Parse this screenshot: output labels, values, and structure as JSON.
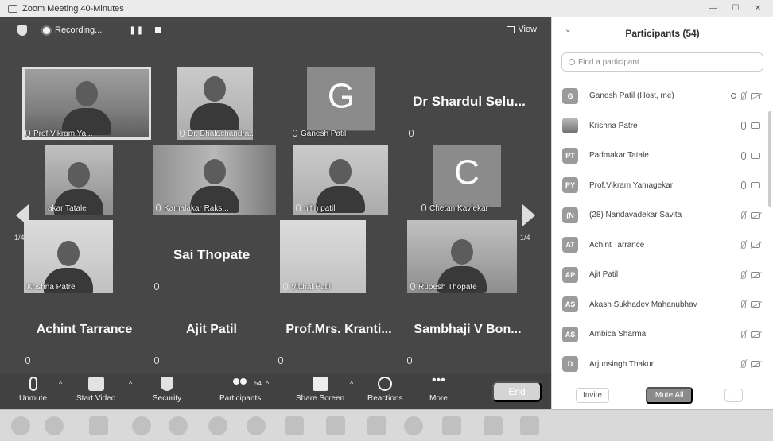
{
  "window": {
    "title": "Zoom Meeting 40-Minutes"
  },
  "topbar": {
    "recording_label": "Recording...",
    "pause_glyph": "❚❚",
    "view_label": "View"
  },
  "tiles": {
    "t1": "Prof.Vikram Ya...",
    "t2": "Dr. Bhalachandra...",
    "t3": "Ganesh Patil",
    "t3_letter": "G",
    "t4": "Dr Shardul Selu...",
    "t5": "akar Tatale",
    "t6": "Kamalakar Raks...",
    "t7": "nitin patil",
    "t8": "Chetan Kavlekar",
    "t8_letter": "C",
    "t9": "Krishna Patre",
    "t10": "Sai Thopate",
    "t11": "Vitthal Patil",
    "t12": "Rupesh Thopate",
    "t13": "Achint Tarrance",
    "t14": "Ajit Patil",
    "t15": "Prof.Mrs. Kranti...",
    "t16": "Sambhaji V Bon..."
  },
  "pager": {
    "left": "1/4",
    "right": "1/4"
  },
  "toolbar": {
    "unmute": "Unmute",
    "start_video": "Start Video",
    "security": "Security",
    "participants": "Participants",
    "participants_count": "54",
    "share_screen": "Share Screen",
    "reactions": "Reactions",
    "more": "More",
    "end": "End"
  },
  "panel": {
    "title": "Participants (54)",
    "search_placeholder": "Find a participant",
    "participants": [
      {
        "initials": "G",
        "name": "Ganesh Patil (Host, me)"
      },
      {
        "initials": "",
        "name": "Krishna Patre"
      },
      {
        "initials": "PT",
        "name": "Padmakar Tatale"
      },
      {
        "initials": "PY",
        "name": "Prof.Vikram Yamagekar"
      },
      {
        "initials": "(N",
        "name": "(28) Nandavadekar Savita"
      },
      {
        "initials": "AT",
        "name": "Achint Tarrance"
      },
      {
        "initials": "AP",
        "name": "Ajit Patil"
      },
      {
        "initials": "AS",
        "name": "Akash Sukhadev Mahanubhav"
      },
      {
        "initials": "AS",
        "name": "Ambica Sharma"
      },
      {
        "initials": "D",
        "name": "Arjunsingh Thakur"
      }
    ],
    "invite": "Invite",
    "mute_all": "Mute All",
    "more": "..."
  },
  "colors": {
    "meeting_bg": "#4a4a4a",
    "panel_bg": "#fafafa",
    "end_button": "#d0d0d0"
  }
}
